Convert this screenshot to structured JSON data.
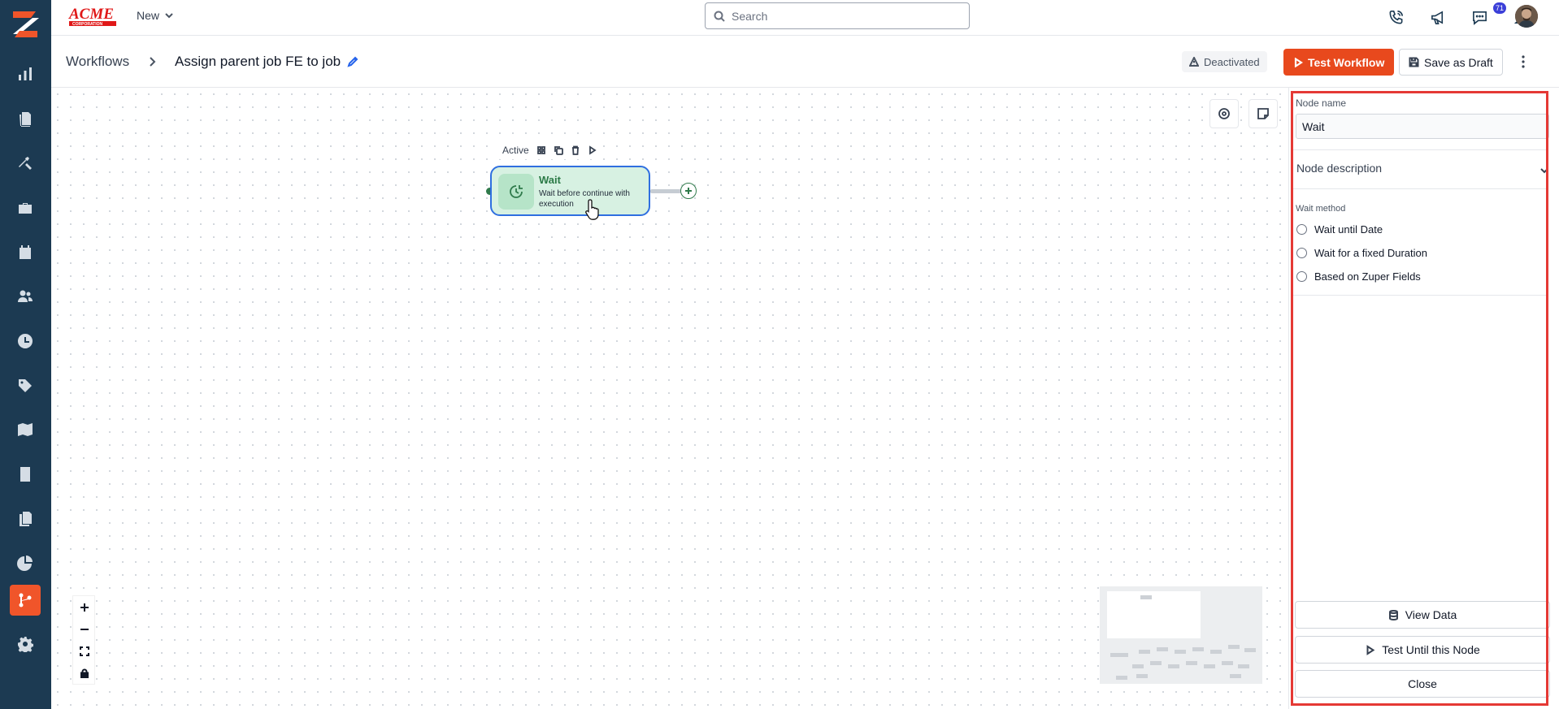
{
  "topbar": {
    "new_label": "New",
    "search_placeholder": "Search",
    "notification_count": "71"
  },
  "pagebar": {
    "breadcrumb_root": "Workflows",
    "workflow_title": "Assign parent job FE to job",
    "status": "Deactivated",
    "test_workflow_label": "Test Workflow",
    "save_draft_label": "Save as Draft"
  },
  "canvas": {
    "node_toolbar_status": "Active",
    "node": {
      "title": "Wait",
      "description": "Wait before continue with execution"
    }
  },
  "panel": {
    "node_name_label": "Node name",
    "node_name_value": "Wait",
    "node_description_label": "Node description",
    "wait_method_label": "Wait method",
    "wait_options": [
      "Wait until Date",
      "Wait for a fixed Duration",
      "Based on Zuper Fields"
    ],
    "view_data_label": "View Data",
    "test_until_label": "Test Until this Node",
    "close_label": "Close"
  },
  "colors": {
    "sidebar_bg": "#1c3a52",
    "accent": "#e8491d",
    "node_fill": "#d7f1e2",
    "node_border": "#2f6fe0",
    "highlight_frame": "#e53935"
  },
  "icons": {
    "sidebar": [
      "dashboard-icon",
      "jobs-icon",
      "tools-icon",
      "briefcase-icon",
      "calendar-icon",
      "users-icon",
      "clock-icon",
      "tag-icon",
      "map-icon",
      "invoice-icon",
      "documents-icon",
      "reports-icon",
      "workflow-icon",
      "settings-icon"
    ],
    "topbar": [
      "phone-icon",
      "megaphone-icon",
      "chat-icon",
      "bell-icon"
    ]
  }
}
